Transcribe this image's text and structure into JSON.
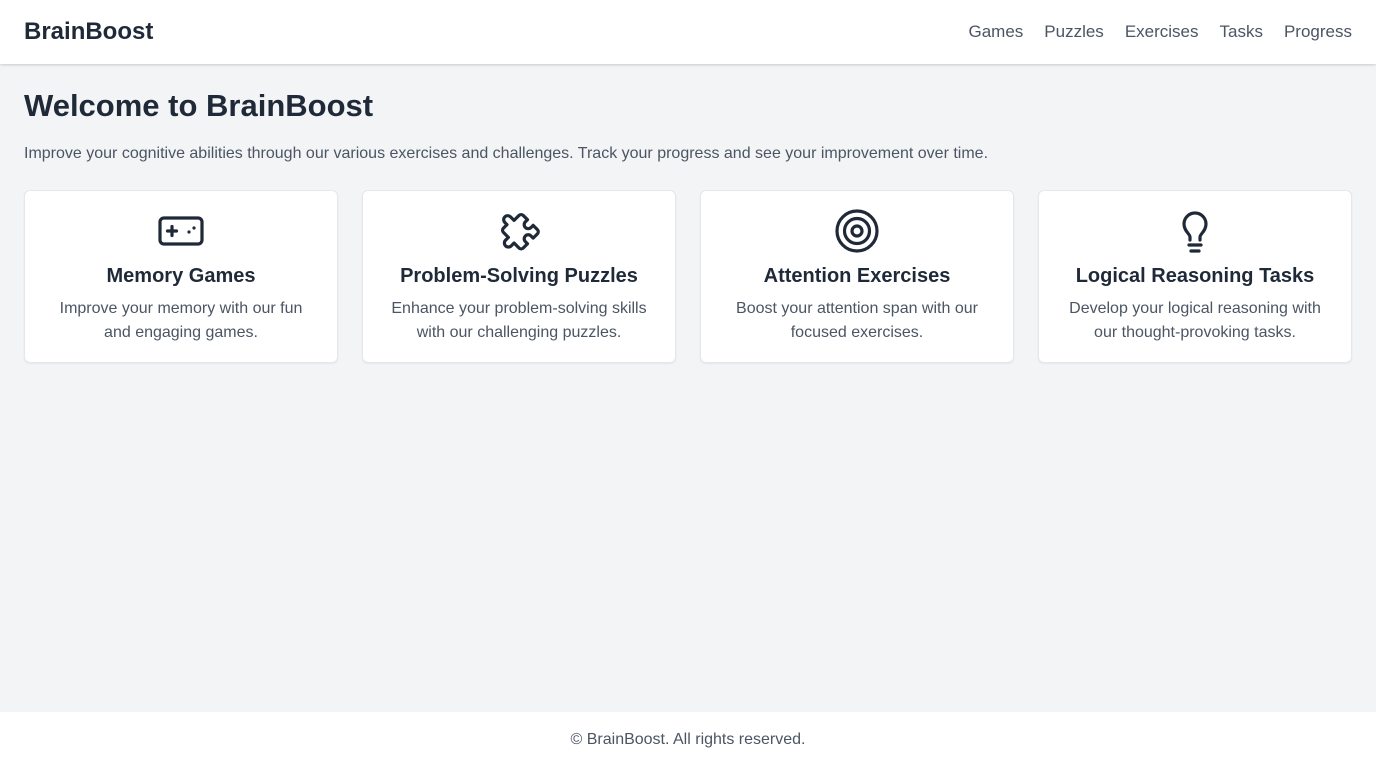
{
  "header": {
    "brand": "BrainBoost",
    "nav": [
      "Games",
      "Puzzles",
      "Exercises",
      "Tasks",
      "Progress"
    ]
  },
  "main": {
    "title": "Welcome to BrainBoost",
    "intro": "Improve your cognitive abilities through our various exercises and challenges. Track your progress and see your improvement over time.",
    "cards": [
      {
        "icon": "gamepad-icon",
        "title": "Memory Games",
        "description": "Improve your memory with our fun and engaging games."
      },
      {
        "icon": "puzzle-icon",
        "title": "Problem-Solving Puzzles",
        "description": "Enhance your problem-solving skills with our challenging puzzles."
      },
      {
        "icon": "target-icon",
        "title": "Attention Exercises",
        "description": "Boost your attention span with our focused exercises."
      },
      {
        "icon": "lightbulb-icon",
        "title": "Logical Reasoning Tasks",
        "description": "Develop your logical reasoning with our thought-provoking tasks."
      }
    ]
  },
  "footer": {
    "text": "© BrainBoost. All rights reserved."
  },
  "colors": {
    "page_background": "#f3f4f6",
    "surface": "#ffffff",
    "text_primary": "#1f2937",
    "text_secondary": "#4b5563",
    "border": "#e5e7eb"
  }
}
